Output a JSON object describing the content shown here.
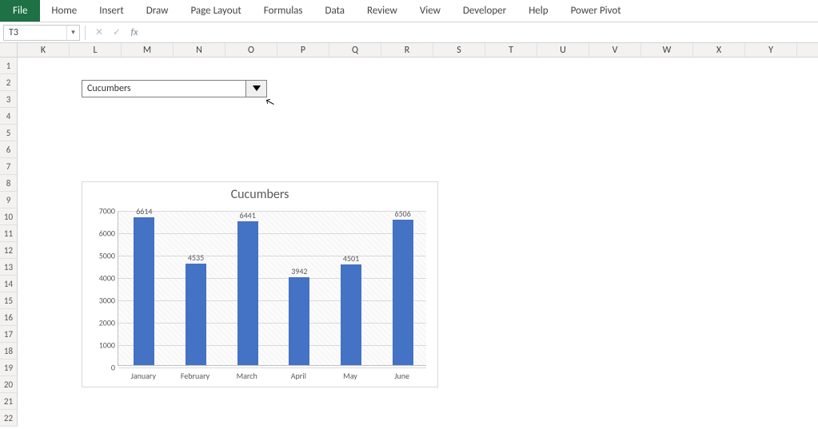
{
  "ribbon": {
    "file": "File",
    "tabs": [
      "Home",
      "Insert",
      "Draw",
      "Page Layout",
      "Formulas",
      "Data",
      "Review",
      "View",
      "Developer",
      "Help",
      "Power Pivot"
    ]
  },
  "namebox": {
    "value": "T3"
  },
  "formula_bar": {
    "cancel_glyph": "✕",
    "enter_glyph": "✓",
    "fx_glyph": "fx"
  },
  "columns": [
    "K",
    "L",
    "M",
    "N",
    "O",
    "P",
    "Q",
    "R",
    "S",
    "T",
    "U",
    "V",
    "W",
    "X",
    "Y"
  ],
  "row_count": 22,
  "form_control": {
    "selected": "Cucumbers"
  },
  "chart_data": {
    "type": "bar",
    "title": "Cucumbers",
    "xlabel": "",
    "ylabel": "",
    "categories": [
      "January",
      "February",
      "March",
      "April",
      "May",
      "June"
    ],
    "values": [
      6614,
      4535,
      6441,
      3942,
      4501,
      6506
    ],
    "ylim": [
      0,
      7000
    ],
    "yticks": [
      0,
      1000,
      2000,
      3000,
      4000,
      5000,
      6000,
      7000
    ]
  }
}
